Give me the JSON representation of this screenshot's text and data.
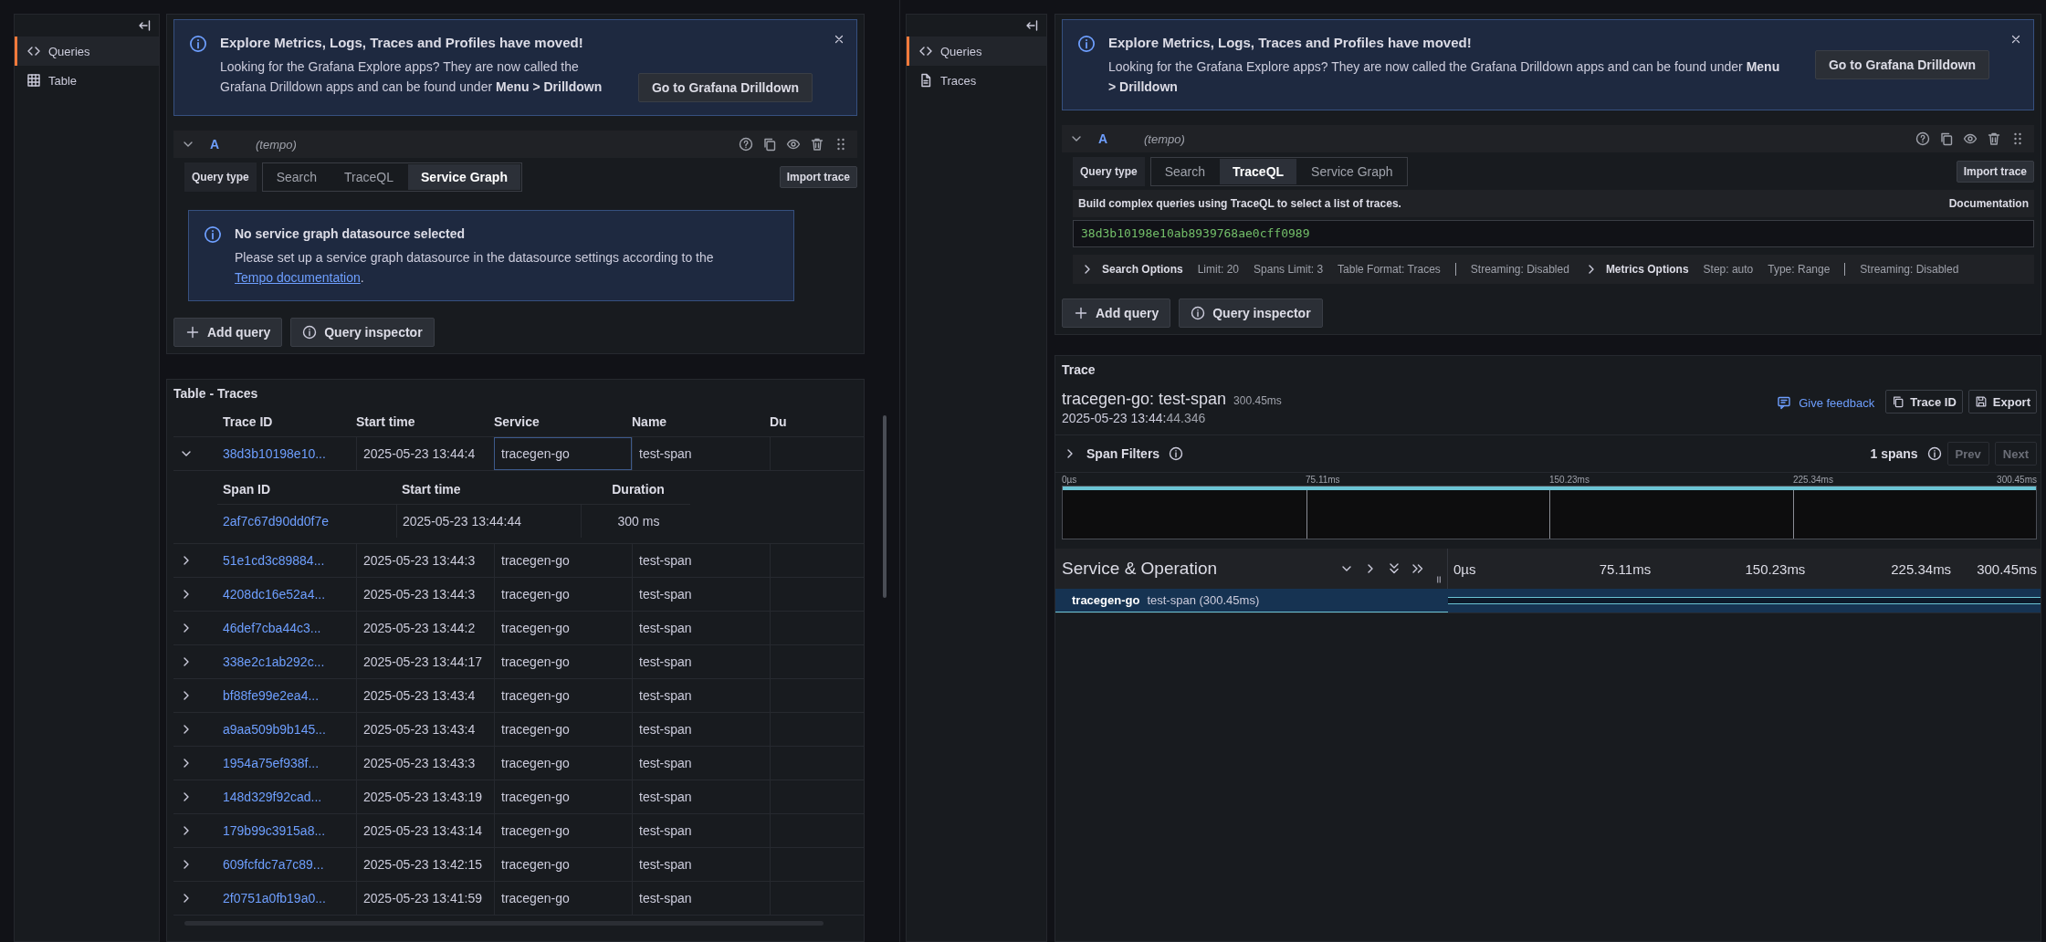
{
  "left": {
    "sidebar": [
      {
        "label": "Queries",
        "kind": "queries",
        "selected": true
      },
      {
        "label": "Table",
        "kind": "table",
        "selected": false
      }
    ],
    "alert": {
      "title": "Explore Metrics, Logs, Traces and Profiles have moved!",
      "body": "Looking for the Grafana Explore apps? They are now called the Grafana Drilldown apps and can be found under **Menu > Drilldown**",
      "button": "Go to Grafana Drilldown"
    },
    "query": {
      "letter": "A",
      "datasource": "(tempo)",
      "query_type_label": "Query type",
      "expanded": true,
      "query_types": [
        {
          "label": "Search",
          "selected": false
        },
        {
          "label": "TraceQL",
          "selected": false
        },
        {
          "label": "Service Graph",
          "selected": true
        }
      ],
      "import_button": "Import trace",
      "notice": {
        "title": "No service graph datasource selected",
        "body": "Please set up a service graph datasource in the datasource settings according to the ",
        "link": "Tempo documentation",
        "body_end": "."
      }
    },
    "actions": [
      {
        "kind": "add",
        "label": "Add query"
      },
      {
        "kind": "inspector",
        "label": "Query inspector"
      }
    ],
    "table": {
      "title": "Table - Traces",
      "columns": [
        "Trace ID",
        "Start time",
        "Service",
        "Name",
        "Du"
      ],
      "rows": [
        {
          "expanded": true,
          "trace_id": "38d3b10198e10...",
          "start_time": "2025-05-23 13:44:4",
          "service": "tracegen-go",
          "name": "test-span",
          "service_focused": true,
          "span_table": {
            "columns": [
              "Span ID",
              "Start time",
              "Duration"
            ],
            "rows": [
              {
                "span_id": "2af7c67d90dd0f7e",
                "start_time": "2025-05-23 13:44:44",
                "duration": "300 ms"
              }
            ]
          }
        },
        {
          "expanded": false,
          "trace_id": "51e1cd3c89884...",
          "start_time": "2025-05-23 13:44:3",
          "service": "tracegen-go",
          "name": "test-span",
          "service_focused": false
        },
        {
          "expanded": false,
          "trace_id": "4208dc16e52a4...",
          "start_time": "2025-05-23 13:44:3",
          "service": "tracegen-go",
          "name": "test-span",
          "service_focused": false
        },
        {
          "expanded": false,
          "trace_id": "46def7cba44c3...",
          "start_time": "2025-05-23 13:44:2",
          "service": "tracegen-go",
          "name": "test-span",
          "service_focused": false
        },
        {
          "expanded": false,
          "trace_id": "338e2c1ab292c...",
          "start_time": "2025-05-23 13:44:17",
          "service": "tracegen-go",
          "name": "test-span",
          "service_focused": false
        },
        {
          "expanded": false,
          "trace_id": "bf88fe99e2ea4...",
          "start_time": "2025-05-23 13:43:4",
          "service": "tracegen-go",
          "name": "test-span",
          "service_focused": false
        },
        {
          "expanded": false,
          "trace_id": "a9aa509b9b145...",
          "start_time": "2025-05-23 13:43:4",
          "service": "tracegen-go",
          "name": "test-span",
          "service_focused": false
        },
        {
          "expanded": false,
          "trace_id": "1954a75ef938f...",
          "start_time": "2025-05-23 13:43:3",
          "service": "tracegen-go",
          "name": "test-span",
          "service_focused": false
        },
        {
          "expanded": false,
          "trace_id": "148d329f92cad...",
          "start_time": "2025-05-23 13:43:19",
          "service": "tracegen-go",
          "name": "test-span",
          "service_focused": false
        },
        {
          "expanded": false,
          "trace_id": "179b99c3915a8...",
          "start_time": "2025-05-23 13:43:14",
          "service": "tracegen-go",
          "name": "test-span",
          "service_focused": false
        },
        {
          "expanded": false,
          "trace_id": "609fcfdc7a7c89...",
          "start_time": "2025-05-23 13:42:15",
          "service": "tracegen-go",
          "name": "test-span",
          "service_focused": false
        },
        {
          "expanded": false,
          "trace_id": "2f0751a0fb19a0...",
          "start_time": "2025-05-23 13:41:59",
          "service": "tracegen-go",
          "name": "test-span",
          "service_focused": false
        }
      ]
    }
  },
  "right": {
    "sidebar": [
      {
        "label": "Queries",
        "kind": "queries",
        "selected": true
      },
      {
        "label": "Traces",
        "kind": "traces",
        "selected": false
      }
    ],
    "alert": {
      "title": "Explore Metrics, Logs, Traces and Profiles have moved!",
      "body": "Looking for the Grafana Explore apps? They are now called the Grafana Drilldown apps and can be found under **Menu > Drilldown**",
      "button": "Go to Grafana Drilldown"
    },
    "query": {
      "letter": "A",
      "datasource": "(tempo)",
      "query_type_label": "Query type",
      "expanded": true,
      "query_types": [
        {
          "label": "Search",
          "selected": false
        },
        {
          "label": "TraceQL",
          "selected": true
        },
        {
          "label": "Service Graph",
          "selected": false
        }
      ],
      "import_button": "Import trace",
      "editor": {
        "help": "Build complex queries using TraceQL to select a list of traces.",
        "doc_link": "Documentation",
        "value": "38d3b10198e10ab8939768ae0cff0989"
      },
      "options": [
        {
          "title": "Search Options",
          "expanded": false,
          "items": [
            "Limit: 20",
            "Spans Limit: 3",
            "Table Format: Traces"
          ],
          "extra": "Streaming: Disabled"
        },
        {
          "title": "Metrics Options",
          "expanded": false,
          "items": [
            "Step: auto",
            "Type: Range"
          ],
          "extra": "Streaming: Disabled"
        }
      ]
    },
    "actions": [
      {
        "kind": "add",
        "label": "Add query"
      },
      {
        "kind": "inspector",
        "label": "Query inspector"
      }
    ],
    "trace": {
      "panel_title": "Trace",
      "name": "tracegen-go: test-span",
      "duration": "300.45ms",
      "date_main": "2025-05-23 13:44:",
      "date_fraction": "44.346",
      "actions": [
        {
          "kind": "feedback",
          "label": "Give feedback"
        },
        {
          "kind": "copy",
          "label": "Trace ID"
        },
        {
          "kind": "export",
          "label": "Export"
        }
      ],
      "span_filters": {
        "label": "Span Filters",
        "expanded": false,
        "count": "1 spans",
        "prev": {
          "label": "Prev",
          "disabled": true
        },
        "next": {
          "label": "Next",
          "disabled": true
        }
      },
      "minimap_ticks": [
        "0µs",
        "75.11ms",
        "150.23ms",
        "225.34ms",
        "300.45ms"
      ],
      "column_title": "Service & Operation",
      "timeline_ticks": [
        "0µs",
        "75.11ms",
        "150.23ms",
        "225.34ms",
        "300.45ms"
      ],
      "spans": [
        {
          "service": "tracegen-go",
          "operation": "test-span (300.45ms)",
          "selected": true,
          "level": 1
        }
      ]
    }
  }
}
